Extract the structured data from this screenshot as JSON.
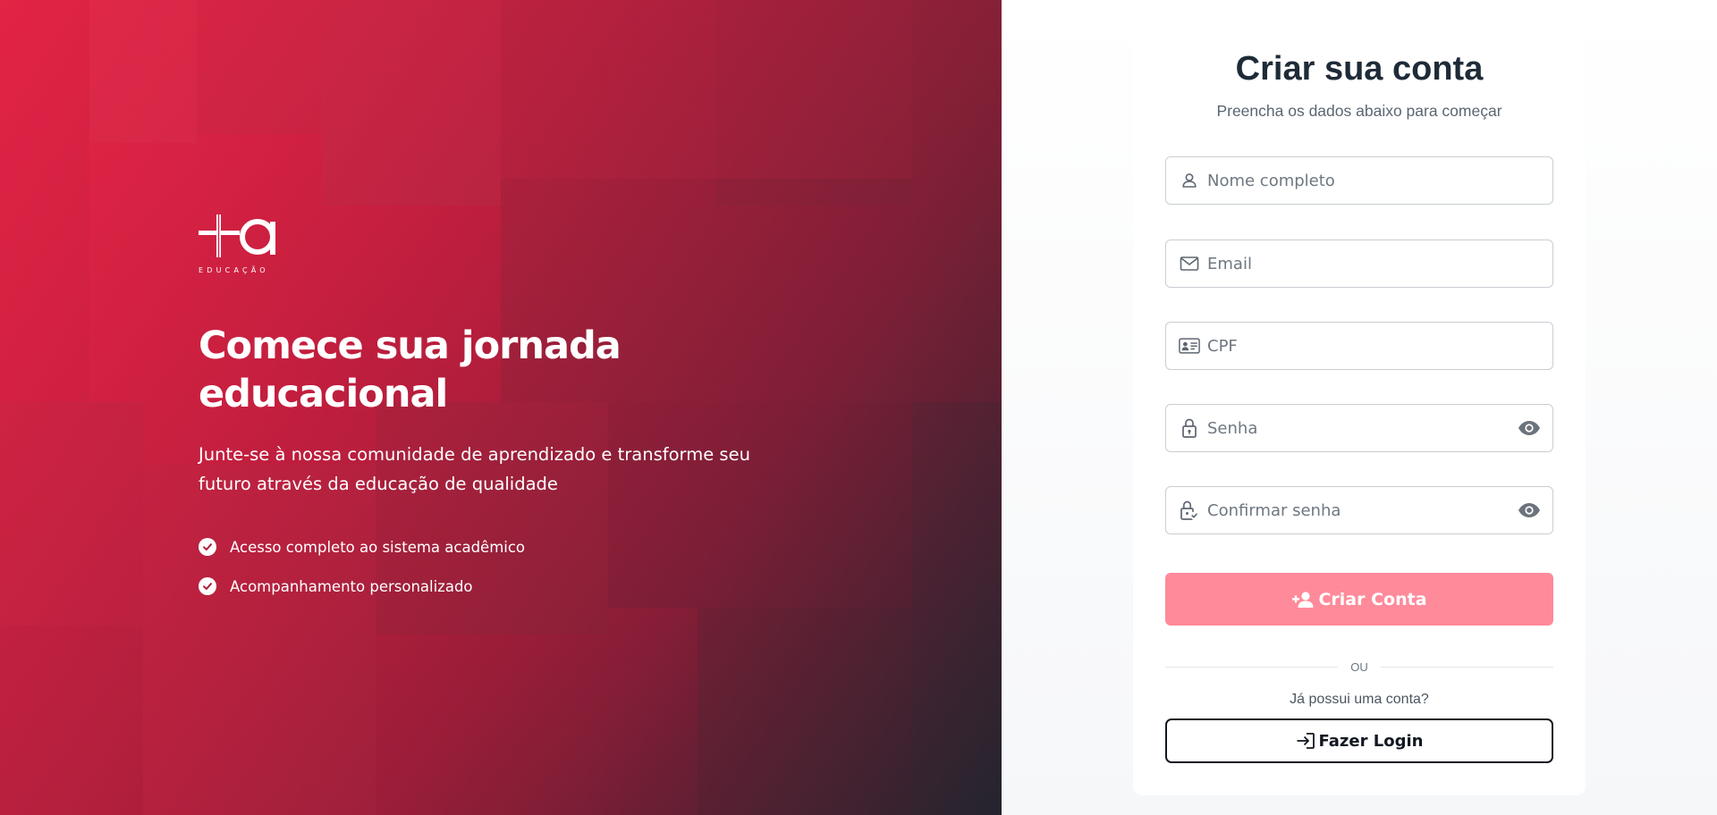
{
  "brand": {
    "logo_text": "+a",
    "logo_subtitle": "EDUCAÇÃO",
    "accent": "#e8284a",
    "button_color": "#ff8a9a"
  },
  "hero": {
    "title_line1": "Comece sua jornada",
    "title_line2": "educacional",
    "subtitle_line1": "Junte-se à nossa comunidade de aprendizado e transforme seu",
    "subtitle_line2": "futuro através da educação de qualidade",
    "features": [
      {
        "icon": "check-circle-icon",
        "label": "Acesso completo ao sistema acadêmico"
      },
      {
        "icon": "check-circle-icon",
        "label": "Acompanhamento personalizado"
      }
    ]
  },
  "form": {
    "title": "Criar sua conta",
    "subtitle": "Preencha os dados abaixo para começar",
    "fields": {
      "name": {
        "icon": "user-icon",
        "placeholder": "Nome completo",
        "value": ""
      },
      "email": {
        "icon": "mail-icon",
        "placeholder": "Email",
        "value": ""
      },
      "cpf": {
        "icon": "id-card-icon",
        "placeholder": "CPF",
        "value": ""
      },
      "password": {
        "icon": "lock-icon",
        "placeholder": "Senha",
        "value": "",
        "toggle_icon": "eye-icon"
      },
      "confirm_password": {
        "icon": "lock-check-icon",
        "placeholder": "Confirmar senha",
        "value": "",
        "toggle_icon": "eye-icon"
      }
    },
    "submit_label": "Criar Conta",
    "submit_icon": "user-plus-icon",
    "divider_text": "OU",
    "have_account_text": "Já possui uma conta?",
    "login_label": "Fazer Login",
    "login_icon": "login-icon"
  }
}
